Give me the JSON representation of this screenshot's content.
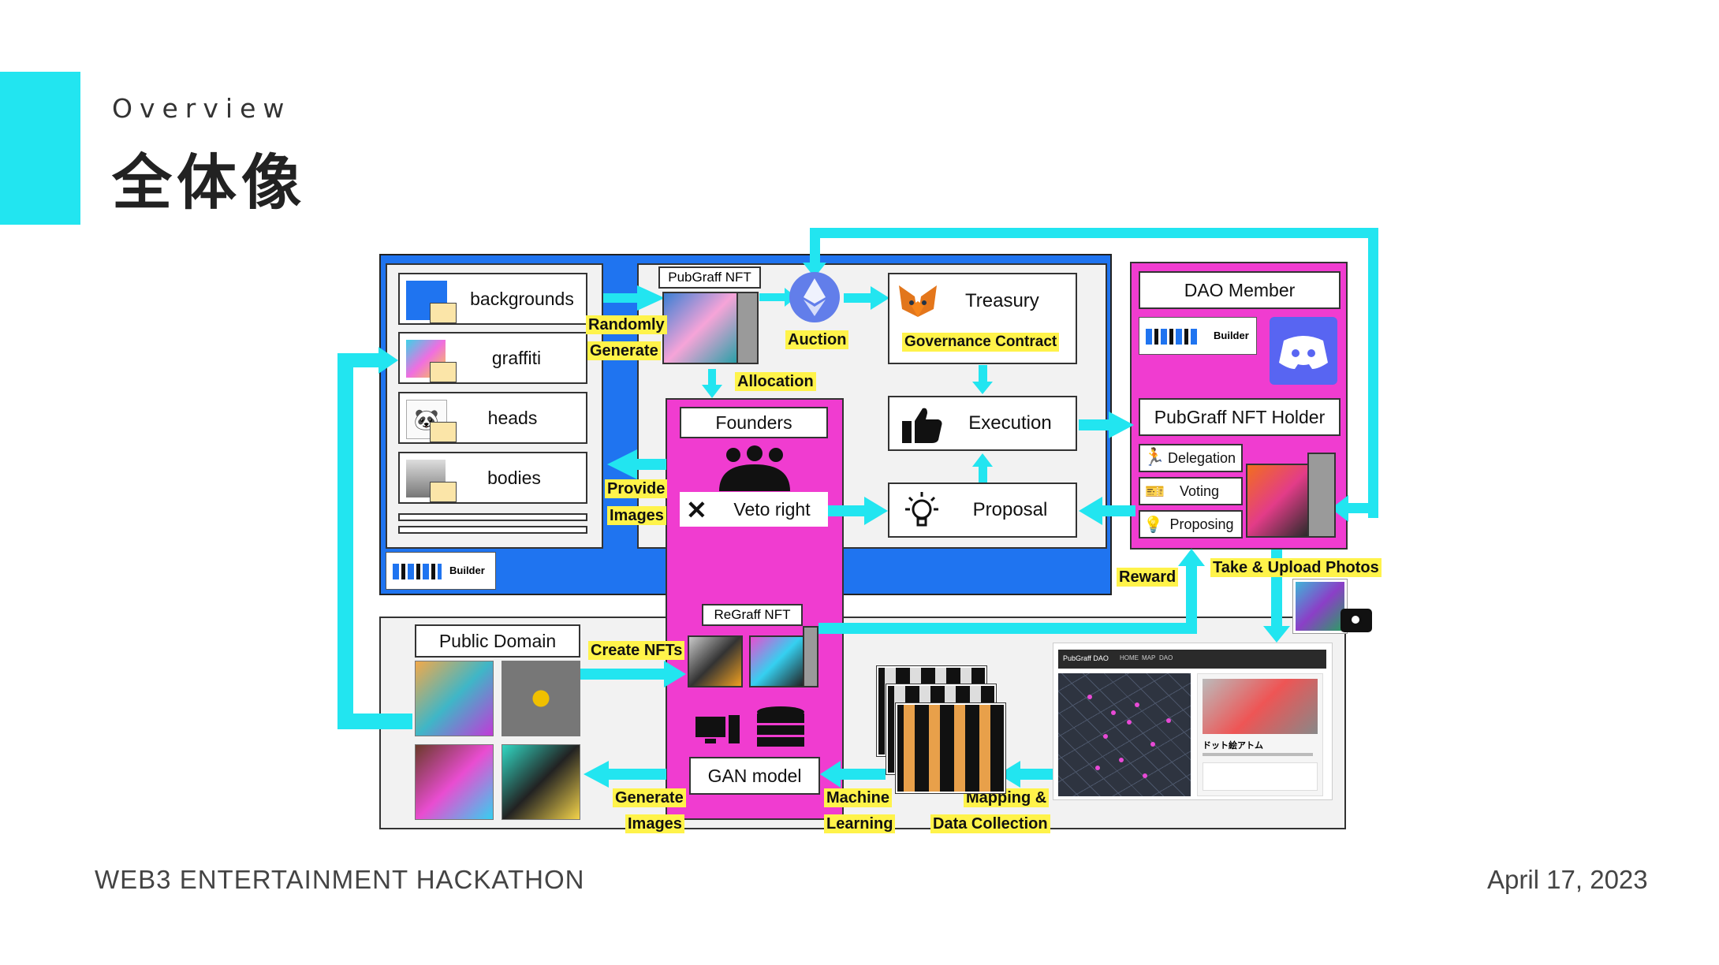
{
  "header": {
    "subtitle": "Overview",
    "title": "全体像"
  },
  "footer": {
    "event": "WEB3 ENTERTAINMENT HACKATHON",
    "date": "April 17, 2023"
  },
  "diagram": {
    "assets": {
      "layers": [
        "backgrounds",
        "graffiti",
        "heads",
        "bodies"
      ],
      "builder_badge": "Builder"
    },
    "nft": {
      "pubgraff_label": "PubGraff NFT",
      "randomly_generate_1": "Randomly",
      "randomly_generate_2": "Generate",
      "auction": "Auction",
      "allocation": "Allocation"
    },
    "founders": {
      "title": "Founders",
      "veto": "Veto right",
      "provide_1": "Provide",
      "provide_2": "Images"
    },
    "treasury": {
      "title": "Treasury",
      "contract": "Governance Contract",
      "execution": "Execution",
      "proposal": "Proposal"
    },
    "dao": {
      "member": "DAO Member",
      "builder_badge": "Builder",
      "holder": "PubGraff NFT Holder",
      "rights": [
        "Delegation",
        "Voting",
        "Proposing"
      ],
      "reward": "Reward",
      "upload": "Take & Upload Photos"
    },
    "public_domain": {
      "title": "Public Domain",
      "create": "Create NFTs",
      "regraff": "ReGraff NFT",
      "gan": "GAN model",
      "generate_1": "Generate",
      "generate_2": "Images",
      "ml_1": "Machine",
      "ml_2": "Learning",
      "map_1": "Mapping &",
      "map_2": "Data Collection"
    },
    "app": {
      "brand": "PubGraff DAO",
      "nav": [
        "HOME",
        "MAP",
        "DAO"
      ],
      "card_title": "ドット絵アトム"
    }
  },
  "colors": {
    "accent": "#22e5f0",
    "blue_panel": "#1f74f0",
    "magenta": "#f03cd0",
    "arrow": "#22e5f0",
    "highlight": "#fff34a"
  }
}
